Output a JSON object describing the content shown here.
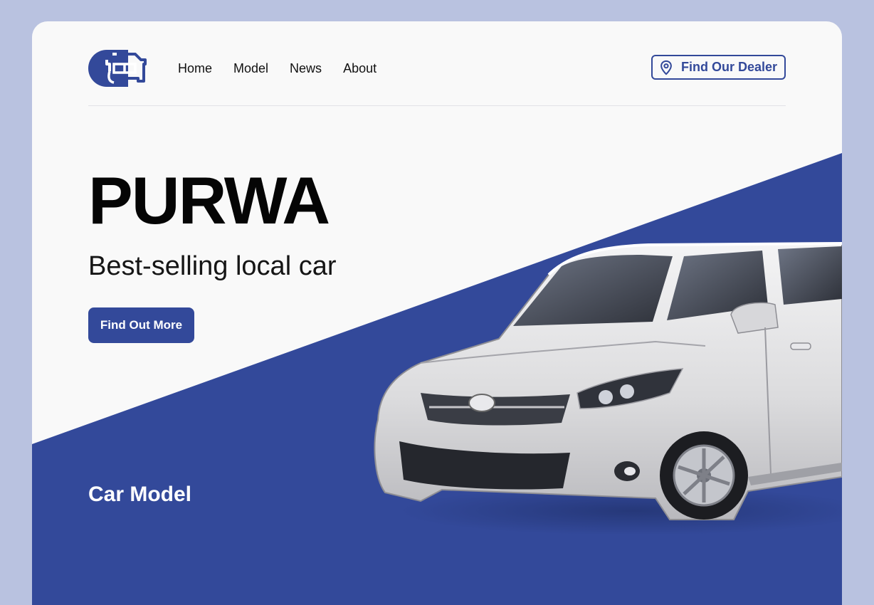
{
  "brand": {
    "logo_icon": "car-logo-icon"
  },
  "nav": {
    "items": [
      {
        "label": "Home"
      },
      {
        "label": "Model"
      },
      {
        "label": "News"
      },
      {
        "label": "About"
      }
    ]
  },
  "dealer_button": {
    "label": "Find Our Dealer",
    "icon": "location-pin-icon"
  },
  "hero": {
    "title": "PURWA",
    "subtitle": "Best-selling local car",
    "cta_label": "Find Out More",
    "image": "white-sedan-car"
  },
  "sections": {
    "car_model_title": "Car Model"
  },
  "colors": {
    "accent": "#33499a",
    "page_background": "#b9c2e0",
    "card_background": "#f9f9f9",
    "text_dark": "#050505",
    "text_light": "#ffffff"
  }
}
